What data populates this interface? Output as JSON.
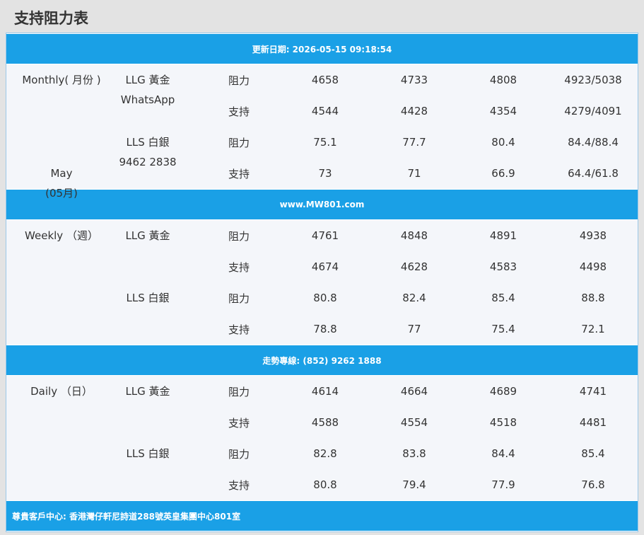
{
  "page_title": "支持阻力表",
  "header_band": "更新日期: 2026-05-15 09:18:54",
  "mid_band_1": "www.MW801.com",
  "mid_band_2": "走勢專線: (852) 9262 1888",
  "footer_band": "尊貴客戶中心: 香港灣仔軒尼詩道288號英皇集團中心801室",
  "sections": [
    {
      "period_lines": [
        "Monthly( 月份 )",
        "",
        "",
        "May",
        "(05月)"
      ],
      "metal1_lines": [
        "LLG 黃金",
        "WhatsApp"
      ],
      "metal2_lines": [
        "LLS 白銀",
        "9462 2838"
      ],
      "rows": [
        {
          "type": "阻力",
          "v": [
            "4658",
            "4733",
            "4808",
            "4923/5038"
          ]
        },
        {
          "type": "支持",
          "v": [
            "4544",
            "4428",
            "4354",
            "4279/4091"
          ]
        },
        {
          "type": "阻力",
          "v": [
            "75.1",
            "77.7",
            "80.4",
            "84.4/88.4"
          ]
        },
        {
          "type": "支持",
          "v": [
            "73",
            "71",
            "66.9",
            "64.4/61.8"
          ]
        }
      ]
    },
    {
      "period_lines": [
        "Weekly （週）"
      ],
      "metal1_lines": [
        "LLG 黃金"
      ],
      "metal2_lines": [
        "LLS 白銀"
      ],
      "rows": [
        {
          "type": "阻力",
          "v": [
            "4761",
            "4848",
            "4891",
            "4938"
          ]
        },
        {
          "type": "支持",
          "v": [
            "4674",
            "4628",
            "4583",
            "4498"
          ]
        },
        {
          "type": "阻力",
          "v": [
            "80.8",
            "82.4",
            "85.4",
            "88.8"
          ]
        },
        {
          "type": "支持",
          "v": [
            "78.8",
            "77",
            "75.4",
            "72.1"
          ]
        }
      ]
    },
    {
      "period_lines": [
        "Daily （日）"
      ],
      "metal1_lines": [
        "LLG 黃金"
      ],
      "metal2_lines": [
        "LLS 白銀"
      ],
      "rows": [
        {
          "type": "阻力",
          "v": [
            "4614",
            "4664",
            "4689",
            "4741"
          ]
        },
        {
          "type": "支持",
          "v": [
            "4588",
            "4554",
            "4518",
            "4481"
          ]
        },
        {
          "type": "阻力",
          "v": [
            "82.8",
            "83.8",
            "84.4",
            "85.4"
          ]
        },
        {
          "type": "支持",
          "v": [
            "80.8",
            "79.4",
            "77.9",
            "76.8"
          ]
        }
      ]
    }
  ],
  "colors": {
    "band": "#1aa0e6",
    "row_bg": "#f4f6fa",
    "page_bg": "#e3e3e3"
  }
}
